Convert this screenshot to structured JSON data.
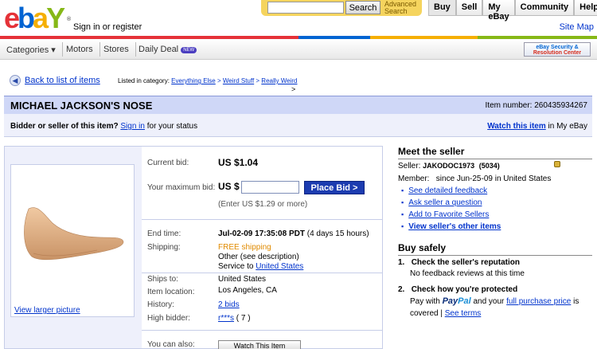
{
  "header": {
    "logo": {
      "e": "e",
      "b": "b",
      "a": "a",
      "y": "Y",
      "tm": "®"
    },
    "signin_label": "Sign in",
    "or_label": " or ",
    "register_label": "register",
    "search_placeholder": "",
    "search_button": "Search",
    "advanced_search_line1": "Advanced",
    "advanced_search_line2": "Search",
    "topnav": [
      "Buy",
      "Sell",
      "My eBay",
      "Community",
      "Help"
    ],
    "sitemap_label": "Site Map"
  },
  "navbar": {
    "categories": "Categories ▾",
    "motors": "Motors",
    "stores": "Stores",
    "daily_deal": "Daily Deal",
    "new_badge": "NEW",
    "security_line1": "eBay Security &",
    "security_line2": "Resolution Center"
  },
  "breadcrumb": {
    "back_label": "Back to list of items",
    "listed_label": "Listed in category:",
    "categories": [
      "Everything Else",
      "Weird Stuff",
      "Really Weird"
    ],
    "separator": " > ",
    "trailing": ">"
  },
  "item": {
    "title": "MICHAEL JACKSON'S NOSE",
    "item_number_label": "Item number:",
    "item_number": "260435934267",
    "bidder_prompt": "Bidder or seller of this item?",
    "signin_link": "Sign in",
    "status_suffix": "for your status",
    "watch_link": "Watch this item",
    "watch_suffix": "in My eBay",
    "view_larger": "View larger picture"
  },
  "bid": {
    "current_bid_label": "Current bid:",
    "current_bid": "US $1.04",
    "max_bid_label": "Your maximum bid:",
    "max_bid_prefix": "US $",
    "max_bid_value": "",
    "place_bid_button": "Place Bid >",
    "min_bid_hint": "(Enter US $1.29 or more)",
    "end_time_label": "End time:",
    "end_time": "Jul-02-09 17:35:08 PDT",
    "time_left": "(4 days 15 hours)",
    "shipping_label": "Shipping:",
    "shipping_free": "FREE shipping",
    "shipping_other": "Other (see description)",
    "service_to_label": "Service to",
    "service_to_link": "United States",
    "ships_to_label": "Ships to:",
    "ships_to": "United States",
    "location_label": "Item location:",
    "location": "Los Angeles, CA",
    "history_label": "History:",
    "history": "2 bids",
    "high_bidder_label": "High bidder:",
    "high_bidder": "r***s",
    "high_bidder_score": "( 7 )",
    "you_can_also_label": "You can also:",
    "watch_button": "Watch This Item"
  },
  "seller": {
    "heading": "Meet the seller",
    "seller_label": "Seller:",
    "seller_name": "JAKODOC1973",
    "feedback_score": "(5034)",
    "member_label": "Member:",
    "member_since": "since Jun-25-09 in United States",
    "links": [
      "See detailed feedback",
      "Ask seller a question",
      "Add to Favorite Sellers",
      "View seller's other items"
    ]
  },
  "safety": {
    "heading": "Buy safely",
    "item1_num": "1.",
    "item1_title": "Check the seller's reputation",
    "item1_text": "No feedback reviews at this time",
    "item2_num": "2.",
    "item2_title": "Check how you're protected",
    "pay_with": "Pay with",
    "paypal_1": "Pay",
    "paypal_2": "Pal",
    "and_your": "and your",
    "purchase_price_link": "full purchase price",
    "is_covered": "is",
    "covered": "covered |",
    "see_terms": "See terms"
  },
  "colors": {
    "title_bar": "#cfd7f7",
    "panel_bg": "#eef0fb",
    "place_bid": "#1c3cb0",
    "link": "#0033cc",
    "free_shipping": "#e08a00"
  }
}
